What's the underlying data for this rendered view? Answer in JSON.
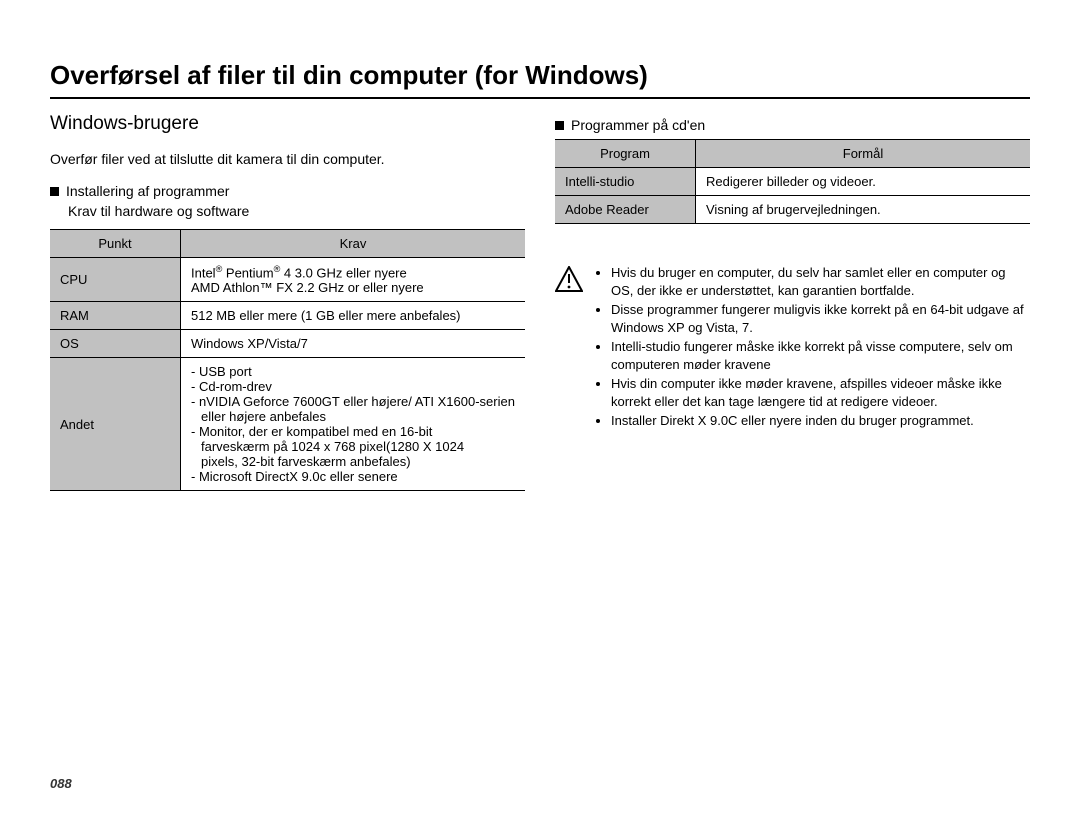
{
  "page_title": "Overførsel af filer til din computer (for Windows)",
  "subtitle": "Windows-brugere",
  "intro": "Overfør filer ved at tilslutte dit kamera til din computer.",
  "section_install": "Installering af programmer",
  "section_install_sub": "Krav til hardware og software",
  "req_header_item": "Punkt",
  "req_header_req": "Krav",
  "req_rows": {
    "cpu_label": "CPU",
    "cpu_line1_pre": "Intel",
    "cpu_line1_mid": " Pentium",
    "cpu_line1_post": " 4 3.0 GHz eller nyere",
    "cpu_line2": "AMD Athlon™ FX 2.2 GHz or eller nyere",
    "ram_label": "RAM",
    "ram_val": "512 MB eller mere (1 GB eller mere anbefales)",
    "os_label": "OS",
    "os_val": "Windows XP/Vista/7",
    "other_label": "Andet",
    "other_l1": "- USB port",
    "other_l2": "- Cd-rom-drev",
    "other_l3": "- nVIDIA Geforce 7600GT eller højere/ ATI X1600-serien eller højere anbefales",
    "other_l4a": "- Monitor, der er kompatibel med en 16-bit",
    "other_l4b": "farveskærm på 1024 x 768 pixel(1280 X 1024",
    "other_l4c": "pixels, 32-bit farveskærm anbefales)",
    "other_l5": "- Microsoft DirectX 9.0c eller senere"
  },
  "section_progs": "Programmer på cd'en",
  "progs_header_prog": "Program",
  "progs_header_purpose": "Formål",
  "progs_rows": {
    "r1_label": "Intelli-studio",
    "r1_val": "Redigerer billeder og videoer.",
    "r2_label": "Adobe Reader",
    "r2_val": "Visning af brugervejledningen."
  },
  "warnings": {
    "w1": "Hvis du bruger en computer, du selv har samlet eller en computer og OS, der ikke er understøttet, kan garantien bortfalde.",
    "w2": "Disse programmer fungerer muligvis ikke korrekt på en 64-bit udgave af Windows XP og Vista, 7.",
    "w3": "Intelli-studio fungerer måske ikke korrekt på visse computere, selv om computeren møder kravene",
    "w4": "Hvis din computer ikke møder kravene, afspilles videoer måske ikke korrekt eller det kan tage længere tid at redigere videoer.",
    "w5": "Installer Direkt X 9.0C eller nyere inden du bruger programmet."
  },
  "page_number": "088",
  "reg_mark": "®"
}
